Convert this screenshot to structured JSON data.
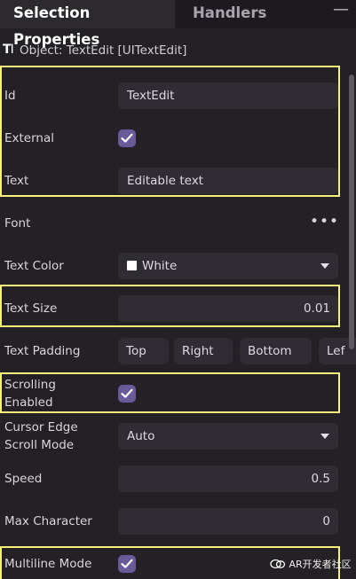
{
  "tabs": {
    "active": "Selection Properties",
    "inactive": "Handlers",
    "minimize": "—"
  },
  "object": {
    "icon": "text-cursor-icon",
    "title": "Object: TextEdit [UITextEdit]"
  },
  "props": {
    "id": {
      "label": "Id",
      "value": "TextEdit"
    },
    "external": {
      "label": "External",
      "checked": true
    },
    "text": {
      "label": "Text",
      "value": "Editable text"
    },
    "font": {
      "label": "Font",
      "more": "•••"
    },
    "text_color": {
      "label": "Text Color",
      "value": "White",
      "swatch": "#ffffff"
    },
    "text_size": {
      "label": "Text Size",
      "value": "0.01"
    },
    "text_padding": {
      "label": "Text Padding",
      "parts": [
        "Top",
        "Right",
        "Bottom",
        "Lef"
      ]
    },
    "scrolling_enabled": {
      "label_line1": "Scrolling",
      "label_line2": "Enabled",
      "checked": true
    },
    "cursor_edge": {
      "label_line1": "Cursor Edge",
      "label_line2": "Scroll Mode",
      "value": "Auto"
    },
    "speed": {
      "label": "Speed",
      "value": "0.5"
    },
    "max_character": {
      "label": "Max Character",
      "value": "0"
    },
    "multiline": {
      "label": "Multiline Mode",
      "checked": true
    }
  },
  "watermark": "AR开发者社区",
  "colors": {
    "accent_check": "#6a5a9a",
    "highlight": "#f4f07a",
    "background": "#232125"
  }
}
